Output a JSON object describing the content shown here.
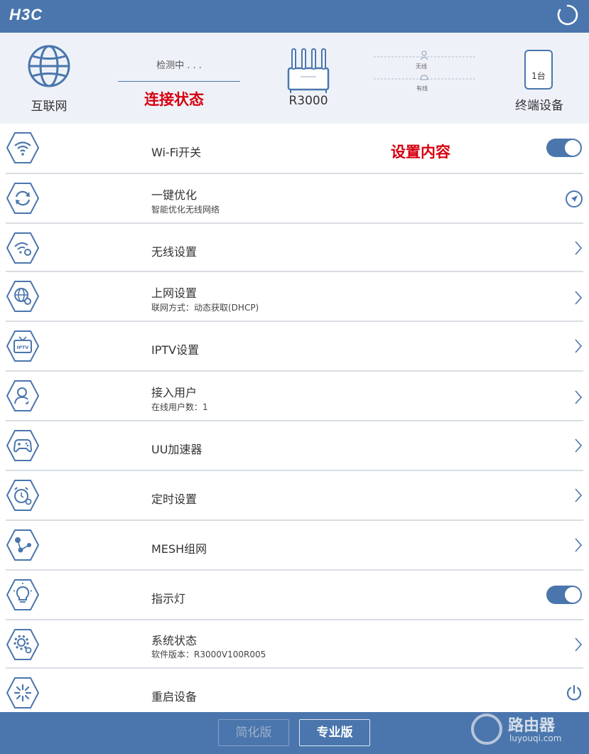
{
  "header": {
    "logo": "H3C",
    "refresh_icon": "refresh-icon",
    "bg_color": "#4a76ad"
  },
  "status_panel": {
    "internet_label": "互联网",
    "detect_text": "检测中 . . .",
    "connection_status_annotation": "连接状态",
    "router_label": "R3000",
    "wireless_label": "无线",
    "wired_label": "有线",
    "device_count": "1台",
    "device_label": "终端设备"
  },
  "content_annotation": "设置内容",
  "menu": [
    {
      "title": "Wi-Fi开关",
      "icon": "wifi-icon",
      "control": "toggle",
      "toggle_on": true
    },
    {
      "title": "一键优化",
      "subtitle": "智能优化无线网络",
      "icon": "refresh-cycle-icon",
      "control": "rocket"
    },
    {
      "title": "无线设置",
      "icon": "wireless-settings-icon",
      "control": "chevron"
    },
    {
      "title": "上网设置",
      "subtitle": "联网方式：动态获取(DHCP)",
      "icon": "globe-settings-icon",
      "control": "chevron"
    },
    {
      "title": "IPTV设置",
      "icon": "iptv-icon",
      "icon_text": "IPTV",
      "control": "chevron"
    },
    {
      "title": "接入用户",
      "subtitle": "在线用户数：1",
      "icon": "user-icon",
      "control": "chevron"
    },
    {
      "title": "UU加速器",
      "icon": "gamepad-icon",
      "control": "chevron"
    },
    {
      "title": "定时设置",
      "icon": "alarm-clock-icon",
      "control": "chevron"
    },
    {
      "title": "MESH组网",
      "icon": "mesh-network-icon",
      "control": "chevron"
    },
    {
      "title": "指示灯",
      "icon": "lightbulb-icon",
      "control": "toggle",
      "toggle_on": true
    },
    {
      "title": "系统状态",
      "subtitle": "软件版本：R3000V100R005",
      "icon": "gear-icon",
      "control": "chevron"
    },
    {
      "title": "重启设备",
      "icon": "restart-icon",
      "control": "power"
    }
  ],
  "footer": {
    "simple_label": "简化版",
    "pro_label": "专业版",
    "watermark_text": "路由器",
    "watermark_url": "luyouqi.com"
  }
}
